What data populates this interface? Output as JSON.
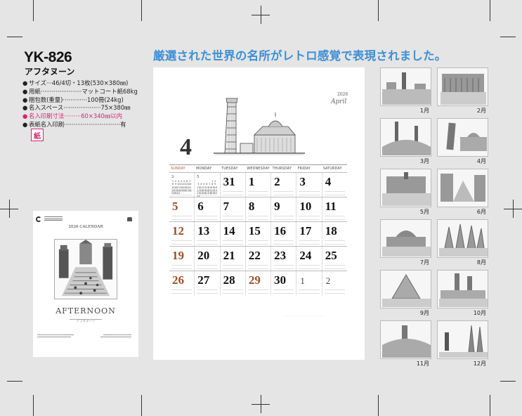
{
  "product": {
    "code": "YK-826",
    "name": "アフタヌーン",
    "specs": [
      {
        "label": "サイズ",
        "value": "46/4切・13枚(530×380㎜)",
        "dots": "···",
        "highlight": false
      },
      {
        "label": "用紙",
        "value": "マットコート紙68kg",
        "dots": "······················",
        "highlight": false
      },
      {
        "label": "梱包数(重量)",
        "value": "100冊(24kg)",
        "dots": "·············",
        "highlight": false
      },
      {
        "label": "名入スペース",
        "value": "75×380㎜",
        "dots": "····················",
        "highlight": false
      },
      {
        "label": "名入印刷寸法",
        "value": "60×340㎜以内",
        "dots": "·········",
        "highlight": true
      },
      {
        "label": "表紙名入印刷",
        "value": "有",
        "dots": "······························",
        "highlight": false
      }
    ],
    "stamp": "紙"
  },
  "headline": "厳選された世界の名所がレトロ感覚で表現されました。",
  "cover": {
    "calendar_label": "2026 CALENDAR",
    "title": "AFTERNOON",
    "subtitle": "アフタヌーン"
  },
  "calendar": {
    "year": "2026",
    "month_name": "April",
    "month_number": "4",
    "weekdays": [
      "SUNDAY",
      "MONDAY",
      "TUESDAY",
      "WEDNESDAY",
      "THURSDAY",
      "FRIDAY",
      "SATURDAY"
    ],
    "mini_prev": {
      "month": "3",
      "days": [
        "1",
        "2",
        "3",
        "4",
        "5",
        "6",
        "7",
        "8",
        "9",
        "10",
        "11",
        "12",
        "13",
        "14",
        "15",
        "16",
        "17",
        "18",
        "19",
        "20",
        "21",
        "22",
        "23",
        "24",
        "25",
        "26",
        "27",
        "28",
        "29",
        "30",
        "31"
      ]
    },
    "mini_next": {
      "month": "5",
      "days": [
        "1",
        "2",
        "3",
        "4",
        "5",
        "6",
        "7",
        "8",
        "9",
        "10",
        "11",
        "12",
        "13",
        "14",
        "15",
        "16",
        "17",
        "18",
        "19",
        "20",
        "21",
        "22",
        "23",
        "24",
        "25",
        "26",
        "27",
        "28",
        "29",
        "30",
        "31"
      ]
    },
    "weeks": [
      [
        "",
        "",
        "31",
        "1",
        "2",
        "3",
        "4"
      ],
      [
        "5",
        "6",
        "7",
        "8",
        "9",
        "10",
        "11"
      ],
      [
        "12",
        "13",
        "14",
        "15",
        "16",
        "17",
        "18"
      ],
      [
        "19",
        "20",
        "21",
        "22",
        "23",
        "24",
        "25"
      ],
      [
        "26",
        "27",
        "28",
        "29",
        "30",
        "1",
        "2"
      ]
    ],
    "red_days": [
      "29"
    ]
  },
  "thumbnails": [
    {
      "label": "1月"
    },
    {
      "label": "2月"
    },
    {
      "label": "3月"
    },
    {
      "label": "4月"
    },
    {
      "label": "5月"
    },
    {
      "label": "6月"
    },
    {
      "label": "7月"
    },
    {
      "label": "8月"
    },
    {
      "label": "9月"
    },
    {
      "label": "10月"
    },
    {
      "label": "11月"
    },
    {
      "label": "12月"
    }
  ],
  "colors": {
    "headline": "#3d8fd4",
    "highlight": "#d3266f",
    "sunday": "#9a4f26"
  }
}
